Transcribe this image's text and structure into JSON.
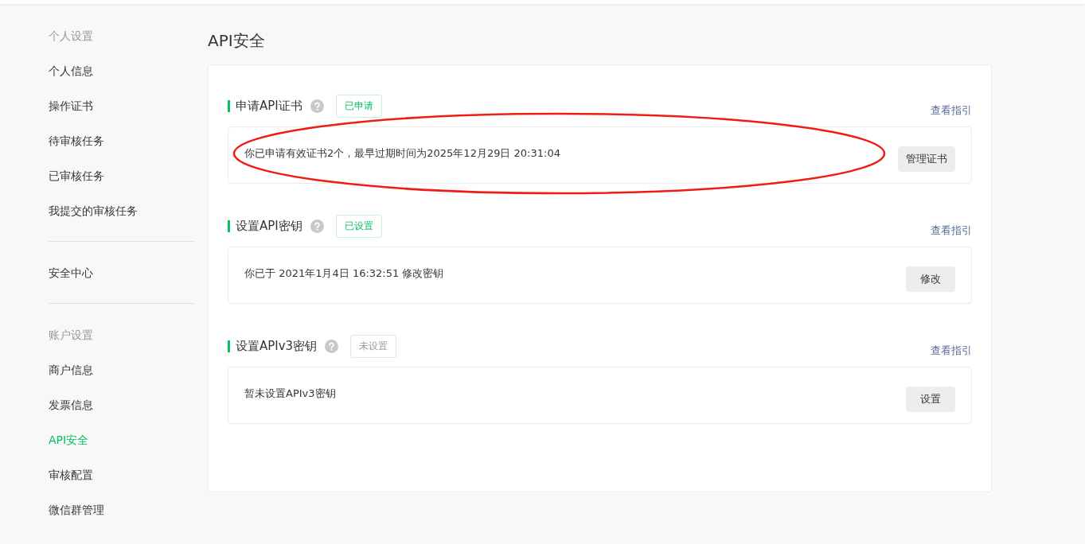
{
  "sidebar": {
    "sections": [
      {
        "heading": "个人设置",
        "items": [
          {
            "label": "个人信息",
            "selected": false
          },
          {
            "label": "操作证书",
            "selected": false
          },
          {
            "label": "待审核任务",
            "selected": false
          },
          {
            "label": "已审核任务",
            "selected": false
          },
          {
            "label": "我提交的审核任务",
            "selected": false
          }
        ]
      },
      {
        "items": [
          {
            "label": "安全中心",
            "selected": false
          }
        ]
      },
      {
        "heading": "账户设置",
        "items": [
          {
            "label": "商户信息",
            "selected": false
          },
          {
            "label": "发票信息",
            "selected": false
          },
          {
            "label": "API安全",
            "selected": true
          },
          {
            "label": "审核配置",
            "selected": false
          },
          {
            "label": "微信群管理",
            "selected": false
          }
        ]
      }
    ]
  },
  "page_title": "API安全",
  "sections": [
    {
      "title": "申请API证书",
      "status": {
        "label": "已申请",
        "active": true
      },
      "guide_link": "查看指引",
      "description": "你已申请有效证书2个，最早过期时间为2025年12月29日 20:31:04",
      "button": "管理证书"
    },
    {
      "title": "设置API密钥",
      "status": {
        "label": "已设置",
        "active": true
      },
      "guide_link": "查看指引",
      "description": "你已于 2021年1月4日 16:32:51 修改密钥",
      "button": "修改"
    },
    {
      "title": "设置APIv3密钥",
      "status": {
        "label": "未设置",
        "active": false
      },
      "guide_link": "查看指引",
      "description": "暂未设置APIv3密钥",
      "button": "设置"
    }
  ]
}
